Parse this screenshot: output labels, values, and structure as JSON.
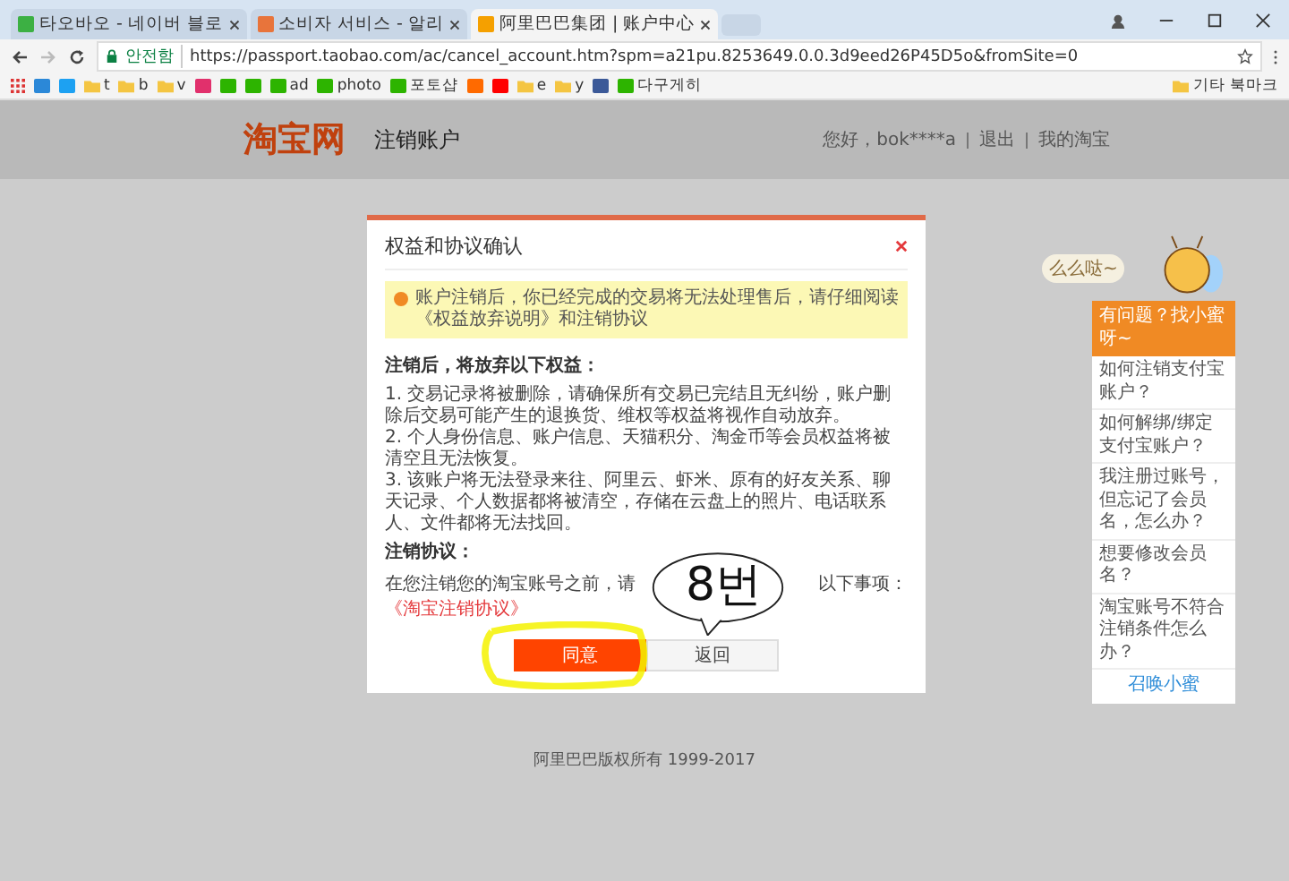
{
  "browser": {
    "tabs": [
      {
        "title": "타오바오 - 네이버 블로",
        "selected": false,
        "color": "#3cb043"
      },
      {
        "title": "소비자 서비스 - 알리",
        "selected": false,
        "color": "#e8743b"
      },
      {
        "title": "阿里巴巴集团 | 账户中心",
        "selected": true,
        "color": "#f5a000"
      }
    ],
    "security": "안전함",
    "url": "https://passport.taobao.com/ac/cancel_account.htm?spm=a21pu.8253649.0.0.3d9eed26P45D5o&fromSite=0",
    "bookmarks": [
      {
        "kind": "site",
        "color": "#2b88d8"
      },
      {
        "kind": "site",
        "color": "#1da1f2"
      },
      {
        "kind": "folder",
        "label": "t"
      },
      {
        "kind": "folder",
        "label": "b"
      },
      {
        "kind": "folder",
        "label": "v"
      },
      {
        "kind": "site",
        "color": "#e1306c"
      },
      {
        "kind": "site",
        "color": "#2db400"
      },
      {
        "kind": "site",
        "color": "#2db400"
      },
      {
        "kind": "site",
        "label": "ad",
        "color": "#2db400"
      },
      {
        "kind": "site",
        "label": "photo",
        "color": "#2db400"
      },
      {
        "kind": "site",
        "label": "포토샵",
        "color": "#2db400"
      },
      {
        "kind": "site",
        "color": "#ff6a00"
      },
      {
        "kind": "site",
        "color": "#ff0000"
      },
      {
        "kind": "folder",
        "label": "e"
      },
      {
        "kind": "folder",
        "label": "y"
      },
      {
        "kind": "site",
        "color": "#3b5998"
      },
      {
        "kind": "site",
        "label": "다구게히",
        "color": "#2db400"
      }
    ],
    "other_bookmarks": "기타 북마크"
  },
  "header": {
    "logo": "淘宝网",
    "title": "注销账户",
    "nav": [
      "您好，bok****a",
      "退出",
      "我的淘宝"
    ]
  },
  "dialog": {
    "title": "权益和协议确认",
    "notice": "账户注销后，你已经完成的交易将无法处理售后，请仔细阅读《权益放弃说明》和注销协议",
    "rights_heading": "注销后，将放弃以下权益：",
    "rights": [
      "1. 交易记录将被删除，请确保所有交易已完结且无纠纷，账户删除后交易可能产生的退换货、维权等权益将视作自动放弃。",
      "2. 个人身份信息、账户信息、天猫积分、淘金币等会员权益将被清空且无法恢复。",
      "3. 该账户将无法登录来往、阿里云、虾米、原有的好友关系、聊天记录、个人数据都将被清空，存储在云盘上的照片、电话联系人、文件都将无法找回。"
    ],
    "agreement_heading": "注销协议：",
    "agreement_start": "在您注销您的淘宝账号之前，请",
    "agreement_end": "以下事项：",
    "agreement_link": "《淘宝注销协议》",
    "buttons": [
      {
        "label": "同意",
        "kind": "primary"
      },
      {
        "label": "返回",
        "kind": "secondary"
      }
    ]
  },
  "footer": "阿里巴巴版权所有 1999-2017",
  "annotation": {
    "text": "8번"
  },
  "help": {
    "greeting": "么么哒~",
    "title": "有问题？找小蜜呀~",
    "items": [
      "如何注销支付宝账户？",
      "如何解绑/绑定支付宝账户？",
      "我注册过账号，但忘记了会员名，怎么办？",
      "想要修改会员名？",
      "淘宝账号不符合注销条件怎么办？"
    ],
    "link": "召唤小蜜"
  }
}
